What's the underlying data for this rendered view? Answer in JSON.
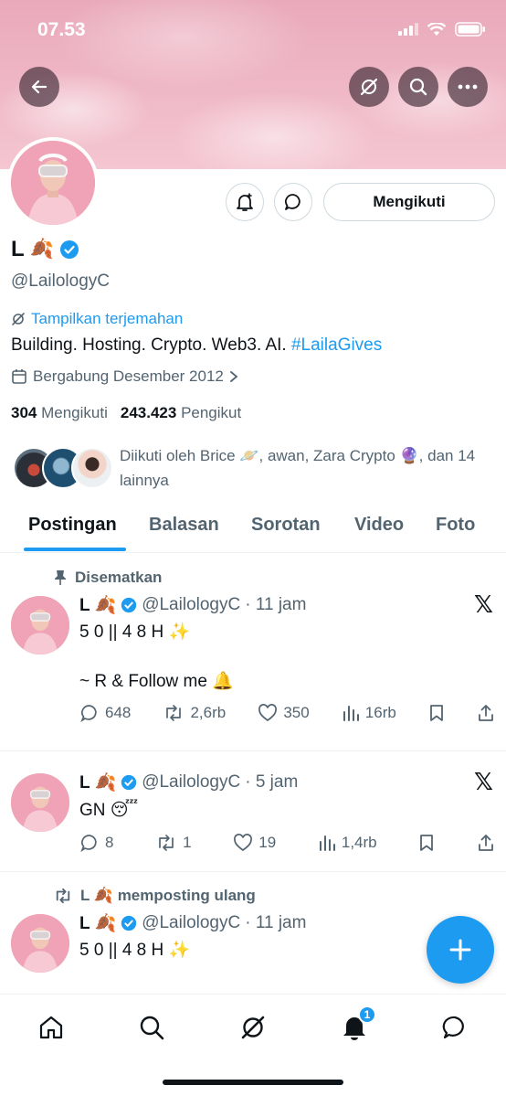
{
  "status_bar": {
    "time": "07.53"
  },
  "profile": {
    "name": "L",
    "name_emoji": "🍂",
    "handle": "@LailologyC",
    "translate_label": "Tampilkan terjemahan",
    "bio_text": "Building. Hosting. Crypto. Web3. AI. ",
    "bio_hashtag": "#LailaGives",
    "joined": "Bergabung Desember 2012",
    "following_count": "304",
    "following_label": "Mengikuti",
    "followers_count": "243.423",
    "followers_label": "Pengikut",
    "followed_by": "Diikuti oleh Brice 🪐, awan, Zara Crypto 🔮, dan 14 lainnya",
    "follow_button": "Mengikuti"
  },
  "tabs": [
    "Postingan",
    "Balasan",
    "Sorotan",
    "Video",
    "Foto"
  ],
  "posts": [
    {
      "context": "Disematkan",
      "name": "L 🍂",
      "handle": "@LailologyC",
      "time": "· 11 jam",
      "text": "5 0 || 4 8 H ✨\n\n~ R & Follow me 🔔",
      "replies": "648",
      "reposts": "2,6rb",
      "likes": "350",
      "views": "16rb"
    },
    {
      "context": "",
      "name": "L 🍂",
      "handle": "@LailologyC",
      "time": "· 5 jam",
      "text": "GN 😴",
      "replies": "8",
      "reposts": "1",
      "likes": "19",
      "views": "1,4rb"
    },
    {
      "context": "L 🍂 memposting ulang",
      "name": "L 🍂",
      "handle": "@LailologyC",
      "time": "· 11 jam",
      "text": "5 0 || 4 8 H ✨"
    }
  ],
  "nav": {
    "notifications_badge": "1"
  },
  "colors": {
    "accent": "#1d9bf0",
    "text": "#0f1419",
    "secondary": "#536471"
  }
}
